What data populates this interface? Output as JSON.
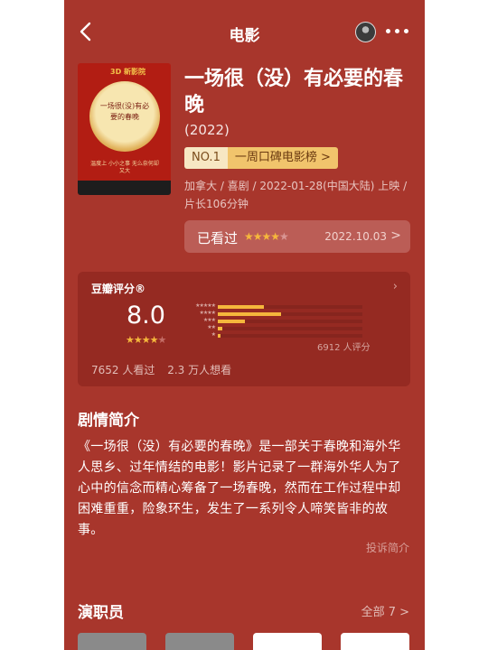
{
  "nav": {
    "title": "电影",
    "back_icon": "chevron-left-icon",
    "more_icon": "more-dots-icon"
  },
  "poster": {
    "brand": "3D 新影院",
    "title_text": "一场很(没)有必要的春晚",
    "tagline": "温度上 小小之事 无么奈何却 又大"
  },
  "movie": {
    "title": "一场很（没）有必要的春晚",
    "year": "(2022)",
    "rank_no": "NO.1",
    "rank_list": "一周口碑电影榜 >",
    "meta": "加拿大 / 喜剧 / 2022-01-28(中国大陆) 上映 / 片长106分钟"
  },
  "watched": {
    "label": "已看过",
    "stars": 4,
    "date": "2022.10.03",
    "chevron": ">"
  },
  "rating": {
    "label": "豆瓣评分®",
    "score": "8.0",
    "stars": 4,
    "distribution": [
      {
        "stars": "★★★★★",
        "value": 0.32
      },
      {
        "stars": "★★★★",
        "value": 0.44
      },
      {
        "stars": "★★★",
        "value": 0.19
      },
      {
        "stars": "★★",
        "value": 0.03
      },
      {
        "stars": "★",
        "value": 0.02
      }
    ],
    "count": "6912 人评分",
    "watched": "7652 人看过",
    "want": "2.3 万人想看",
    "accent": "#f5b73c"
  },
  "synopsis": {
    "heading": "剧情简介",
    "body": "《一场很（没）有必要的春晚》是一部关于春晚和海外华人思乡、过年情结的电影！影片记录了一群海外华人为了心中的信念而精心筹备了一场春晚，然而在工作过程中却困难重重，险象环生，发生了一系列令人啼笑皆非的故事。",
    "report": "投诉简介"
  },
  "cast": {
    "heading": "演职员",
    "all": "全部 7 >"
  }
}
